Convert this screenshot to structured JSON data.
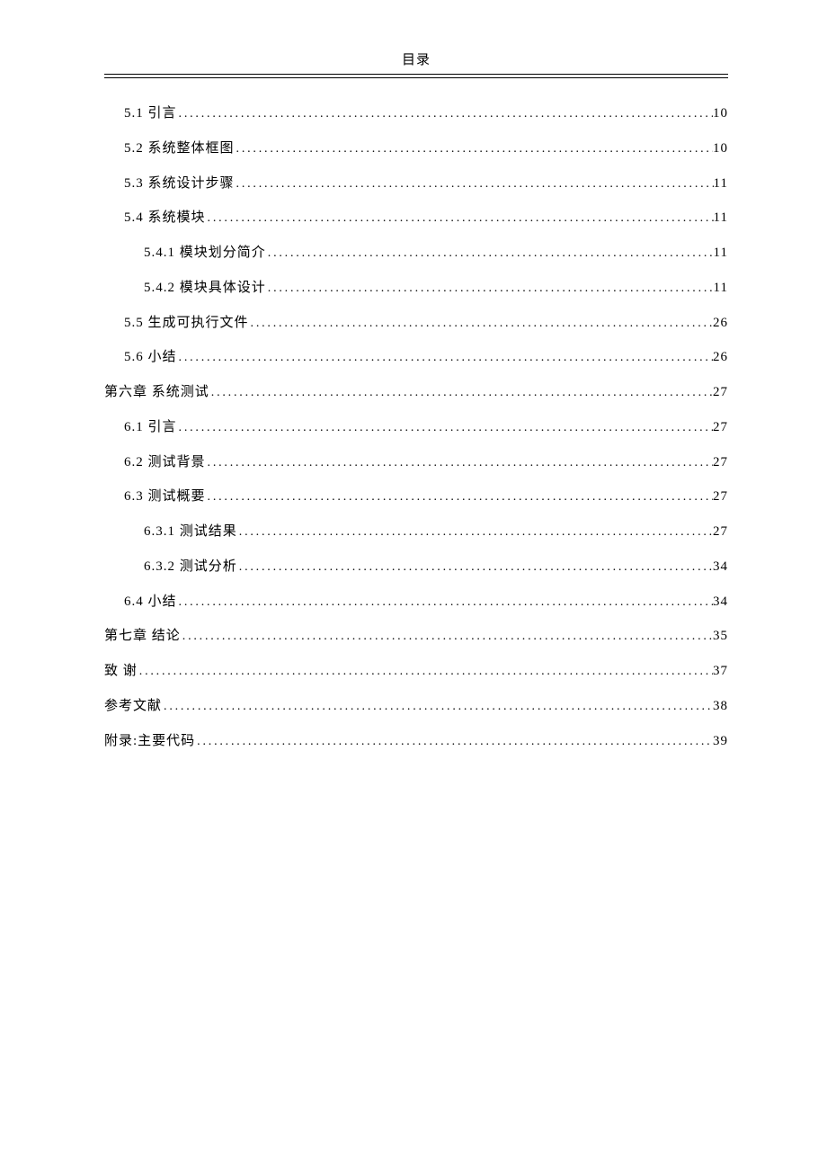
{
  "header": {
    "title": "目录"
  },
  "toc": [
    {
      "level": 1,
      "label": "5.1 引言",
      "page": "10"
    },
    {
      "level": 1,
      "label": "5.2 系统整体框图",
      "page": "10"
    },
    {
      "level": 1,
      "label": "5.3 系统设计步骤",
      "page": "11"
    },
    {
      "level": 1,
      "label": "5.4 系统模块",
      "page": "11"
    },
    {
      "level": 2,
      "label": "5.4.1 模块划分简介",
      "page": "11"
    },
    {
      "level": 2,
      "label": "5.4.2 模块具体设计",
      "page": "11"
    },
    {
      "level": 1,
      "label": "5.5 生成可执行文件",
      "page": "26"
    },
    {
      "level": 1,
      "label": "5.6 小结",
      "page": "26"
    },
    {
      "level": 0,
      "label": "第六章  系统测试",
      "page": "27"
    },
    {
      "level": 1,
      "label": "6.1 引言",
      "page": "27"
    },
    {
      "level": 1,
      "label": "6.2 测试背景",
      "page": "27"
    },
    {
      "level": 1,
      "label": "6.3 测试概要",
      "page": "27"
    },
    {
      "level": 2,
      "label": "6.3.1 测试结果",
      "page": "27"
    },
    {
      "level": 2,
      "label": "6.3.2 测试分析",
      "page": "34"
    },
    {
      "level": 1,
      "label": "6.4 小结",
      "page": "34"
    },
    {
      "level": 0,
      "label": "第七章  结论",
      "page": "35"
    },
    {
      "level": 0,
      "label": "致 谢",
      "page": "37"
    },
    {
      "level": 0,
      "label": "参考文献",
      "page": "38"
    },
    {
      "level": 0,
      "label": "附录:主要代码",
      "page": "39"
    }
  ]
}
